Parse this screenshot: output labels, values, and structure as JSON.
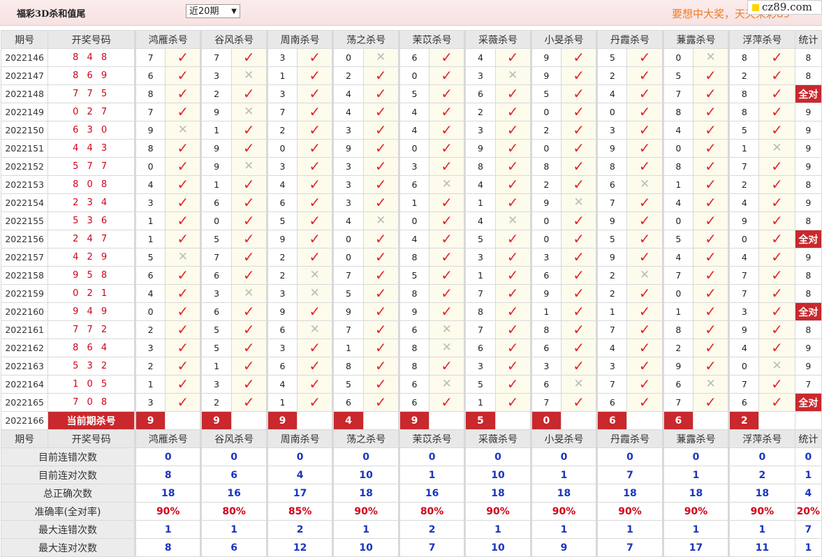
{
  "header": {
    "title": "福彩3D杀和值尾",
    "range_select": "近20期",
    "slogan": "要想中大奖，天天来彩89",
    "logo_text": "cz89.com"
  },
  "columns": {
    "period": "期号",
    "numbers": "开奖号码",
    "experts": [
      "鸿雁杀号",
      "谷风杀号",
      "周南杀号",
      "荡之杀号",
      "茉苡杀号",
      "采薇杀号",
      "小旻杀号",
      "丹霞杀号",
      "蒹露杀号",
      "浮萍杀号"
    ],
    "stat": "统计"
  },
  "all_correct_label": "全对",
  "rows": [
    {
      "p": "2022146",
      "n": "8 4 8",
      "k": [
        7,
        7,
        3,
        0,
        6,
        4,
        9,
        5,
        0,
        8
      ],
      "ok": [
        1,
        1,
        1,
        0,
        1,
        1,
        1,
        1,
        0,
        1
      ],
      "s": "8"
    },
    {
      "p": "2022147",
      "n": "8 6 9",
      "k": [
        6,
        3,
        1,
        2,
        0,
        3,
        9,
        2,
        5,
        2
      ],
      "ok": [
        1,
        0,
        1,
        1,
        1,
        0,
        1,
        1,
        1,
        1
      ],
      "s": "8"
    },
    {
      "p": "2022148",
      "n": "7 7 5",
      "k": [
        8,
        2,
        3,
        4,
        5,
        6,
        5,
        4,
        7,
        8
      ],
      "ok": [
        1,
        1,
        1,
        1,
        1,
        1,
        1,
        1,
        1,
        1
      ],
      "s": "全对"
    },
    {
      "p": "2022149",
      "n": "0 2 7",
      "k": [
        7,
        9,
        7,
        4,
        4,
        2,
        0,
        0,
        8,
        8
      ],
      "ok": [
        1,
        0,
        1,
        1,
        1,
        1,
        1,
        1,
        1,
        1
      ],
      "s": "9"
    },
    {
      "p": "2022150",
      "n": "6 3 0",
      "k": [
        9,
        1,
        2,
        3,
        4,
        3,
        2,
        3,
        4,
        5
      ],
      "ok": [
        0,
        1,
        1,
        1,
        1,
        1,
        1,
        1,
        1,
        1
      ],
      "s": "9"
    },
    {
      "p": "2022151",
      "n": "4 4 3",
      "k": [
        8,
        9,
        0,
        9,
        0,
        9,
        0,
        9,
        0,
        1
      ],
      "ok": [
        1,
        1,
        1,
        1,
        1,
        1,
        1,
        1,
        1,
        0
      ],
      "s": "9"
    },
    {
      "p": "2022152",
      "n": "5 7 7",
      "k": [
        0,
        9,
        3,
        3,
        3,
        8,
        8,
        8,
        8,
        7
      ],
      "ok": [
        1,
        0,
        1,
        1,
        1,
        1,
        1,
        1,
        1,
        1
      ],
      "s": "9"
    },
    {
      "p": "2022153",
      "n": "8 0 8",
      "k": [
        4,
        1,
        4,
        3,
        6,
        4,
        2,
        6,
        1,
        2
      ],
      "ok": [
        1,
        1,
        1,
        1,
        0,
        1,
        1,
        0,
        1,
        1
      ],
      "s": "8"
    },
    {
      "p": "2022154",
      "n": "2 3 4",
      "k": [
        3,
        6,
        6,
        3,
        1,
        1,
        9,
        7,
        4,
        4
      ],
      "ok": [
        1,
        1,
        1,
        1,
        1,
        1,
        0,
        1,
        1,
        1
      ],
      "s": "9"
    },
    {
      "p": "2022155",
      "n": "5 3 6",
      "k": [
        1,
        0,
        5,
        4,
        0,
        4,
        0,
        9,
        0,
        9
      ],
      "ok": [
        1,
        1,
        1,
        0,
        1,
        0,
        1,
        1,
        1,
        1
      ],
      "s": "8"
    },
    {
      "p": "2022156",
      "n": "2 4 7",
      "k": [
        1,
        5,
        9,
        0,
        4,
        5,
        0,
        5,
        5,
        0
      ],
      "ok": [
        1,
        1,
        1,
        1,
        1,
        1,
        1,
        1,
        1,
        1
      ],
      "s": "全对"
    },
    {
      "p": "2022157",
      "n": "4 2 9",
      "k": [
        5,
        7,
        2,
        0,
        8,
        3,
        3,
        9,
        4,
        4
      ],
      "ok": [
        0,
        1,
        1,
        1,
        1,
        1,
        1,
        1,
        1,
        1
      ],
      "s": "9"
    },
    {
      "p": "2022158",
      "n": "9 5 8",
      "k": [
        6,
        6,
        2,
        7,
        5,
        1,
        6,
        2,
        7,
        7
      ],
      "ok": [
        1,
        1,
        0,
        1,
        1,
        1,
        1,
        0,
        1,
        1
      ],
      "s": "8"
    },
    {
      "p": "2022159",
      "n": "0 2 1",
      "k": [
        4,
        3,
        3,
        5,
        8,
        7,
        9,
        2,
        0,
        7
      ],
      "ok": [
        1,
        0,
        0,
        1,
        1,
        1,
        1,
        1,
        1,
        1
      ],
      "s": "8"
    },
    {
      "p": "2022160",
      "n": "9 4 9",
      "k": [
        0,
        6,
        9,
        9,
        9,
        8,
        1,
        1,
        1,
        3
      ],
      "ok": [
        1,
        1,
        1,
        1,
        1,
        1,
        1,
        1,
        1,
        1
      ],
      "s": "全对"
    },
    {
      "p": "2022161",
      "n": "7 7 2",
      "k": [
        2,
        5,
        6,
        7,
        6,
        7,
        8,
        7,
        8,
        9
      ],
      "ok": [
        1,
        1,
        0,
        1,
        0,
        1,
        1,
        1,
        1,
        1
      ],
      "s": "8"
    },
    {
      "p": "2022162",
      "n": "8 6 4",
      "k": [
        3,
        5,
        3,
        1,
        8,
        6,
        6,
        4,
        2,
        4
      ],
      "ok": [
        1,
        1,
        1,
        1,
        0,
        1,
        1,
        1,
        1,
        1
      ],
      "s": "9"
    },
    {
      "p": "2022163",
      "n": "5 3 2",
      "k": [
        2,
        1,
        6,
        8,
        8,
        3,
        3,
        3,
        9,
        0
      ],
      "ok": [
        1,
        1,
        1,
        1,
        1,
        1,
        1,
        1,
        1,
        0
      ],
      "s": "9"
    },
    {
      "p": "2022164",
      "n": "1 0 5",
      "k": [
        1,
        3,
        4,
        5,
        6,
        5,
        6,
        7,
        6,
        7
      ],
      "ok": [
        1,
        1,
        1,
        1,
        0,
        1,
        0,
        1,
        0,
        1
      ],
      "s": "7"
    },
    {
      "p": "2022165",
      "n": "7 0 8",
      "k": [
        3,
        2,
        1,
        6,
        6,
        1,
        7,
        6,
        7,
        6
      ],
      "ok": [
        1,
        1,
        1,
        1,
        1,
        1,
        1,
        1,
        1,
        1
      ],
      "s": "全对"
    }
  ],
  "current": {
    "period": "2022166",
    "label": "当前期杀号",
    "kills": [
      "9",
      "9",
      "9",
      "4",
      "9",
      "5",
      "0",
      "6",
      "6",
      "2"
    ]
  },
  "summary": [
    {
      "label": "目前连错次数",
      "vals": [
        "0",
        "0",
        "0",
        "0",
        "0",
        "0",
        "0",
        "0",
        "0",
        "0"
      ],
      "stat": "0",
      "pct": false
    },
    {
      "label": "目前连对次数",
      "vals": [
        "8",
        "6",
        "4",
        "10",
        "1",
        "10",
        "1",
        "7",
        "1",
        "2"
      ],
      "stat": "1",
      "pct": false
    },
    {
      "label": "总正确次数",
      "vals": [
        "18",
        "16",
        "17",
        "18",
        "16",
        "18",
        "18",
        "18",
        "18",
        "18"
      ],
      "stat": "4",
      "pct": false
    },
    {
      "label": "准确率(全对率)",
      "vals": [
        "90%",
        "80%",
        "85%",
        "90%",
        "80%",
        "90%",
        "90%",
        "90%",
        "90%",
        "90%"
      ],
      "stat": "20%",
      "pct": true
    },
    {
      "label": "最大连错次数",
      "vals": [
        "1",
        "1",
        "2",
        "1",
        "2",
        "1",
        "1",
        "1",
        "1",
        "1"
      ],
      "stat": "7",
      "pct": false
    },
    {
      "label": "最大连对次数",
      "vals": [
        "8",
        "6",
        "12",
        "10",
        "7",
        "10",
        "9",
        "7",
        "17",
        "11"
      ],
      "stat": "1",
      "pct": false
    }
  ]
}
